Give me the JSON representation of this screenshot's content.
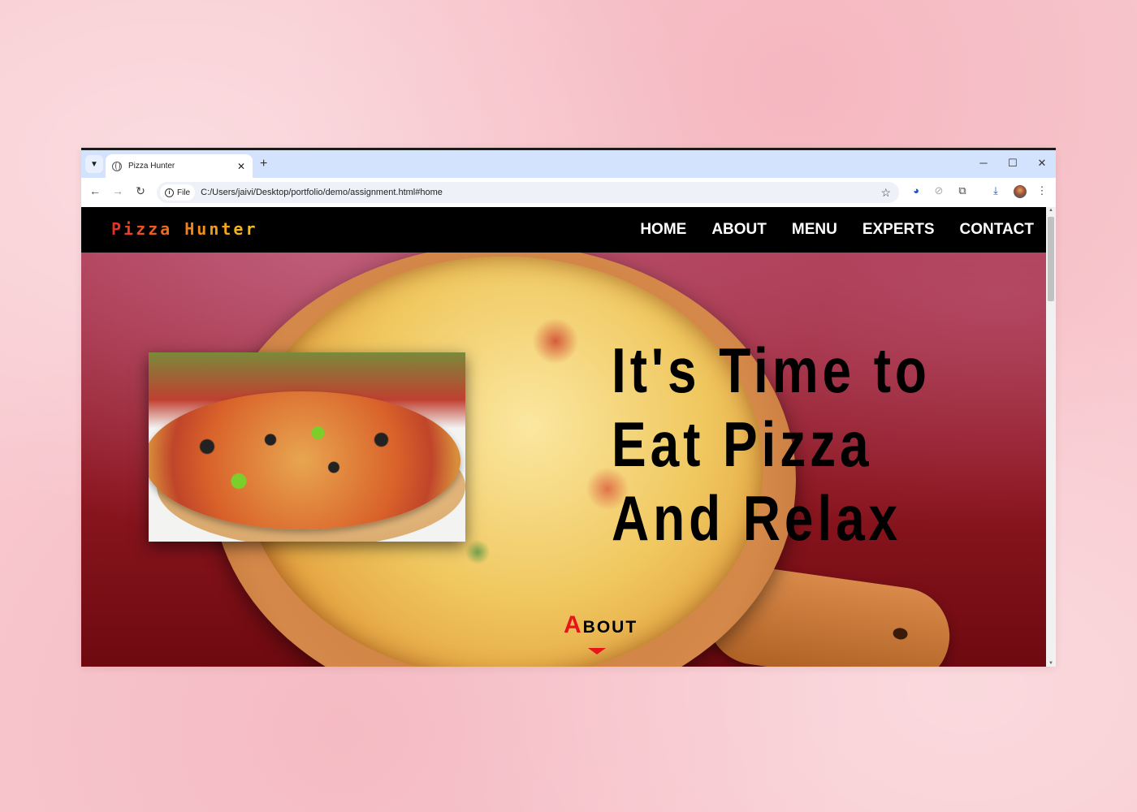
{
  "browser": {
    "tab_title": "Pizza Hunter",
    "new_tab": "+",
    "tab_close": "✕",
    "address_chip": "File",
    "url": "C:/Users/jaivi/Desktop/portfolio/demo/assignment.html#home",
    "window_controls": {
      "minimize": "─",
      "maximize": "☐",
      "close": "✕"
    }
  },
  "site": {
    "logo": "Pizza Hunter",
    "nav": [
      "HOME",
      "ABOUT",
      "MENU",
      "EXPERTS",
      "CONTACT"
    ],
    "hero": {
      "lines": [
        "It's Time to",
        "Eat Pizza",
        "And Relax"
      ]
    },
    "about": {
      "first_letter": "A",
      "rest": "BOUT"
    }
  },
  "colors": {
    "logo_gradient": [
      "#e52d27",
      "#f0781e",
      "#f5c518"
    ],
    "about_accent": "#e8141c",
    "nav_bg": "#000000",
    "tabstrip_bg": "#d3e3fd"
  }
}
